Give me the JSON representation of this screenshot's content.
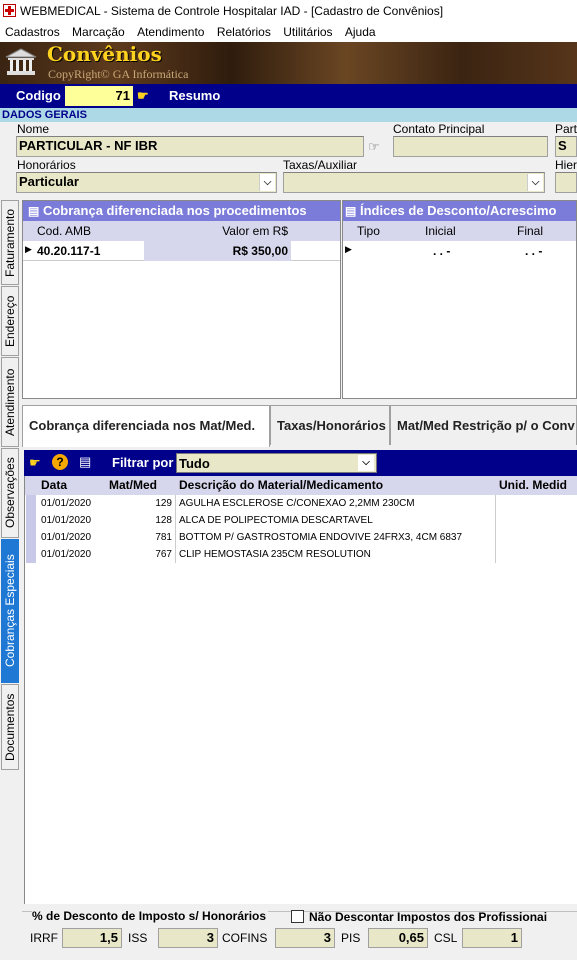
{
  "window": {
    "title": "WEBMEDICAL - Sistema de Controle Hospitalar IAD - [Cadastro de Convênios]"
  },
  "menu": [
    "Cadastros",
    "Marcação",
    "Atendimento",
    "Relatórios",
    "Utilitários",
    "Ajuda"
  ],
  "banner": {
    "title": "Convênios",
    "subtitle": "CopyRight© GA Informática"
  },
  "codebar": {
    "codigo_label": "Codigo",
    "codigo_value": "71",
    "resumo_label": "Resumo"
  },
  "section": {
    "dados_gerais": "DADOS GERAIS"
  },
  "fields": {
    "nome_label": "Nome",
    "nome_value": "PARTICULAR - NF IBR",
    "contato_label": "Contato Principal",
    "contato_value": "",
    "part_label": "Part",
    "part_value": "S",
    "honorarios_label": "Honorários",
    "honorarios_value": "Particular",
    "taxas_label": "Taxas/Auxiliar",
    "taxas_value": "",
    "hier_label": "Hier"
  },
  "side_tabs": [
    "Faturamento",
    "Endereço",
    "Atendimento",
    "Observações",
    "Cobranças Especiais",
    "Documentos"
  ],
  "left_panel": {
    "title": "Cobrança diferenciada nos procedimentos",
    "col_cod": "Cod. AMB",
    "col_valor": "Valor em R$",
    "rows": [
      {
        "cod": "40.20.117-1",
        "valor": "R$ 350,00"
      }
    ]
  },
  "right_panel": {
    "title": "Índices de Desconto/Acrescimo",
    "col_tipo": "Tipo",
    "col_inicial": "Inicial",
    "col_final": "Final",
    "row_inicial": ". .  -",
    "row_final": ". .  -"
  },
  "tabs": [
    "Cobrança diferenciada nos Mat/Med.",
    "Taxas/Honorários",
    "Mat/Med Restrição p/ o Conv"
  ],
  "filter": {
    "label": "Filtrar por",
    "value": "Tudo"
  },
  "matmed": {
    "col_data": "Data",
    "col_matmed": "Mat/Med",
    "col_desc": "Descrição do Material/Medicamento",
    "col_unid": "Unid. Medid",
    "rows": [
      {
        "data": "01/01/2020",
        "matmed": "129",
        "desc": "AGULHA ESCLEROSE C/CONEXAO 2,2MM 230CM"
      },
      {
        "data": "01/01/2020",
        "matmed": "128",
        "desc": "ALCA DE POLIPECTOMIA DESCARTAVEL"
      },
      {
        "data": "01/01/2020",
        "matmed": "781",
        "desc": "BOTTOM P/ GASTROSTOMIA ENDOVIVE 24FRX3, 4CM 6837"
      },
      {
        "data": "01/01/2020",
        "matmed": "767",
        "desc": "CLIP HEMOSTASIA 235CM RESOLUTION"
      }
    ]
  },
  "impostos": {
    "title": "% de Desconto de Imposto s/ Honorários",
    "checkbox_label": "Não Descontar Impostos dos Profissionai",
    "irrf_label": "IRRF",
    "irrf": "1,5",
    "iss_label": "ISS",
    "iss": "3",
    "cofins_label": "COFINS",
    "cofins": "3",
    "pis_label": "PIS",
    "pis": "0,65",
    "csl_label": "CSL",
    "csl": "1"
  }
}
